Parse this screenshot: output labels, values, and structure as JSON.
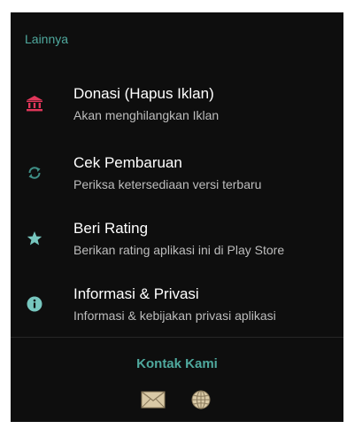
{
  "section": {
    "header": "Lainnya"
  },
  "items": [
    {
      "title": "Donasi (Hapus Iklan)",
      "subtitle": "Akan menghilangkan Iklan",
      "icon": "bank-icon",
      "icon_color": "#e0365a"
    },
    {
      "title": "Cek Pembaruan",
      "subtitle": "Periksa ketersediaan versi terbaru",
      "icon": "refresh-icon",
      "icon_color": "#3f8f86"
    },
    {
      "title": "Beri Rating",
      "subtitle": "Berikan rating aplikasi ini di Play Store",
      "icon": "star-icon",
      "icon_color": "#77c7bf"
    },
    {
      "title": "Informasi & Privasi",
      "subtitle": "Informasi & kebijakan privasi aplikasi",
      "icon": "info-icon",
      "icon_color": "#77c7bf"
    }
  ],
  "contact": {
    "title": "Kontak Kami",
    "icons": [
      "mail-icon",
      "globe-icon"
    ]
  },
  "colors": {
    "background": "#0e0e0e",
    "accent": "#4fa99e",
    "text": "#ffffff",
    "subtext": "#bdbdbd"
  }
}
